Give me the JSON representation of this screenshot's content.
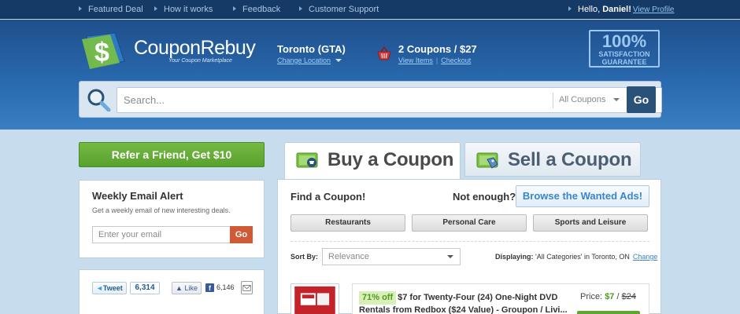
{
  "topbar": {
    "nav": [
      "Featured Deal",
      "How it works",
      "Feedback",
      "Customer Support"
    ],
    "hello_prefix": "Hello, ",
    "user_name": "Daniel!",
    "view_profile": "View Profile"
  },
  "header": {
    "logo_text": "CouponRebuy",
    "logo_tagline": "Your Coupon Marketplace",
    "location": {
      "city": "Toronto (GTA)",
      "change": "Change Location"
    },
    "cart": {
      "summary": "2 Coupons / $27",
      "view_items": "View Items",
      "separator": "|",
      "checkout": "Checkout"
    },
    "guarantee": {
      "percent": "100%",
      "line1": "SATISFACTION",
      "line2": "GUARANTEE"
    }
  },
  "search": {
    "placeholder": "Search...",
    "category": "All Coupons",
    "go_label": "Go"
  },
  "sidebar": {
    "refer_label": "Refer a Friend, Get $10",
    "email_alert": {
      "title": "Weekly Email Alert",
      "description": "Get a weekly email of new interesting deals.",
      "placeholder": "Enter your email",
      "go_label": "Go"
    },
    "social": {
      "tweet_label": "Tweet",
      "tweet_count": "6,314",
      "like_label": "Like",
      "fb_count": "6,146"
    }
  },
  "main": {
    "tabs": [
      {
        "label": "Buy a Coupon",
        "active": true
      },
      {
        "label": "Sell a Coupon",
        "active": false
      }
    ],
    "find_title": "Find a Coupon!",
    "not_enough": "Not enough?",
    "browse_label": "Browse the Wanted Ads!",
    "categories": [
      "Restaurants",
      "Personal Care",
      "Sports and Leisure"
    ],
    "sort": {
      "label": "Sort By:",
      "placeholder": "Relevance"
    },
    "displaying": {
      "label": "Displaying:",
      "text": "'All Categories' in Toronto, ON",
      "change": "Change"
    },
    "coupon": {
      "discount": "71% off",
      "title": "$7 for Twenty-Four (24) One-Night DVD Rentals from Redbox ($24 Value) - Groupon / Livi...",
      "price_label": "Price:",
      "price_now": "$7",
      "price_sep": "/",
      "price_was": "$24"
    }
  },
  "colors": {
    "topbar": "#163a66",
    "header": "#2a6bb0",
    "accent_green": "#5ea62f",
    "accent_orange": "#cf5a35",
    "link_blue": "#3a86c8"
  }
}
